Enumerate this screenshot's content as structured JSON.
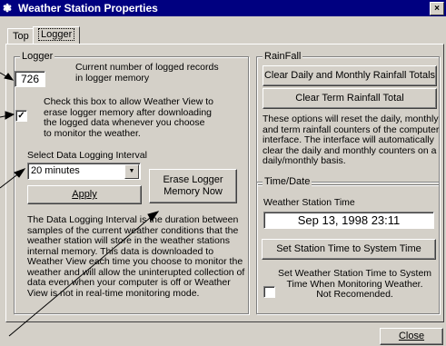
{
  "window": {
    "title": "Weather Station Properties",
    "close_glyph": "×"
  },
  "tabs": [
    {
      "label": "Top"
    },
    {
      "label": "Logger"
    }
  ],
  "logger": {
    "group_title": "Logger",
    "record_count": "726",
    "record_count_caption_1": "Current number of logged records",
    "record_count_caption_2": "in logger memory",
    "erase_checkbox_checked": true,
    "erase_text": [
      "Check this box to allow Weather View to",
      "erase logger memory after downloading",
      "the logged data whenever you choose",
      "to monitor the weather."
    ],
    "interval_label": "Select Data Logging Interval",
    "interval_value": "20 minutes",
    "apply_label": "Apply",
    "erase_button_line1": "Erase Logger",
    "erase_button_line2": "Memory Now",
    "description": [
      "The Data Logging Interval is the duration between",
      "samples of the current weather conditions that the",
      "weather station will store in the weather stations",
      "internal memory.  This data is downloaded to",
      "Weather View each time you choose to monitor the",
      "weather and will allow the uninterupted collection of",
      "data even when your computer is off or Weather",
      "View is not in real-time monitoring mode."
    ]
  },
  "rainfall": {
    "group_title": "RainFall",
    "clear_daily_label": "Clear Daily and Monthly Rainfall Totals",
    "clear_term_label": "Clear Term Rainfall Total",
    "description": [
      "These options will reset the daily, monthly",
      "and term rainfall counters of the computer",
      "interface. The interface will automatically",
      "clear the daily and monthly counters on a",
      "daily/monthly basis."
    ]
  },
  "timedate": {
    "group_title": "Time/Date",
    "station_time_label": "Weather Station Time",
    "station_time_value": "Sep 13, 1998  23:11",
    "set_time_label": "Set Station Time to System Time",
    "auto_set_checked": false,
    "auto_set_text": [
      "Set Weather Station Time to System",
      "Time When Monitoring Weather.",
      "Not Recomended."
    ]
  },
  "footer": {
    "close_label": "Close"
  }
}
